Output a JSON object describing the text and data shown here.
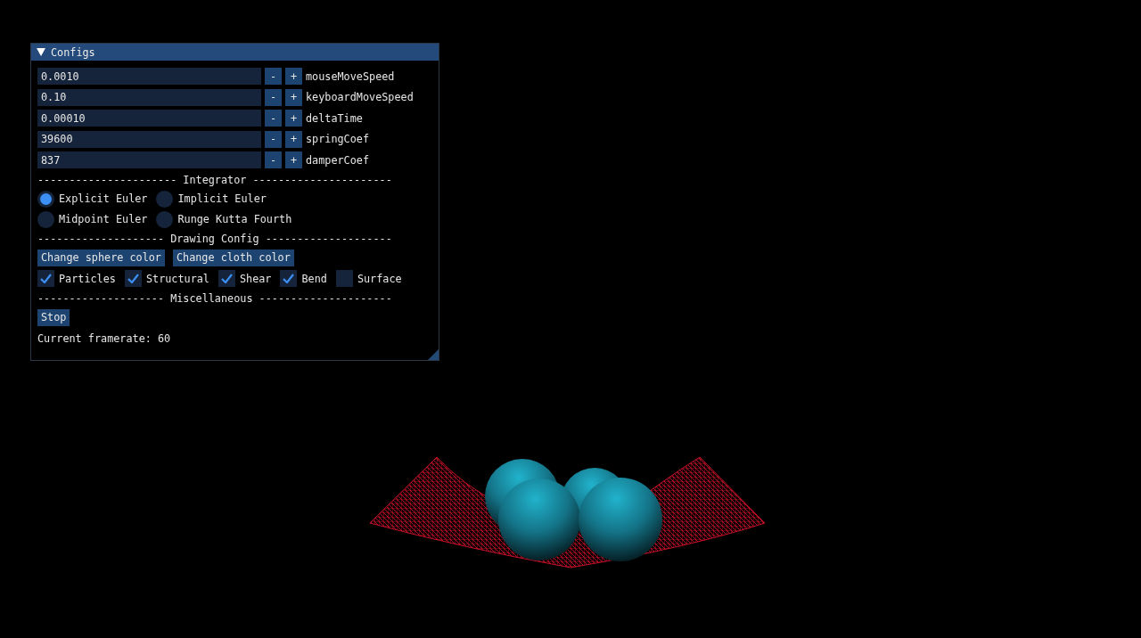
{
  "window": {
    "title": "Configs",
    "expanded": true
  },
  "params": [
    {
      "value": "0.0010",
      "minus": "-",
      "plus": "+",
      "label": "mouseMoveSpeed"
    },
    {
      "value": "0.10",
      "minus": "-",
      "plus": "+",
      "label": "keyboardMoveSpeed"
    },
    {
      "value": "0.00010",
      "minus": "-",
      "plus": "+",
      "label": "deltaTime"
    },
    {
      "value": "39600",
      "minus": "-",
      "plus": "+",
      "label": "springCoef"
    },
    {
      "value": "837",
      "minus": "-",
      "plus": "+",
      "label": "damperCoef"
    }
  ],
  "integrator": {
    "separator": "---------------------- Integrator ----------------------",
    "options": [
      {
        "label": "Explicit Euler",
        "selected": true
      },
      {
        "label": "Implicit Euler",
        "selected": false
      },
      {
        "label": "Midpoint Euler",
        "selected": false
      },
      {
        "label": "Runge Kutta Fourth",
        "selected": false
      }
    ]
  },
  "drawing": {
    "separator": "-------------------- Drawing Config --------------------",
    "buttons": [
      "Change sphere color",
      "Change cloth color"
    ],
    "checkboxes": [
      {
        "label": "Particles",
        "checked": true
      },
      {
        "label": "Structural",
        "checked": true
      },
      {
        "label": "Shear",
        "checked": true
      },
      {
        "label": "Bend",
        "checked": true
      },
      {
        "label": "Surface",
        "checked": false
      }
    ]
  },
  "misc": {
    "separator": "-------------------- Miscellaneous ---------------------",
    "button": "Stop",
    "framerate": "Current framerate: 60"
  }
}
